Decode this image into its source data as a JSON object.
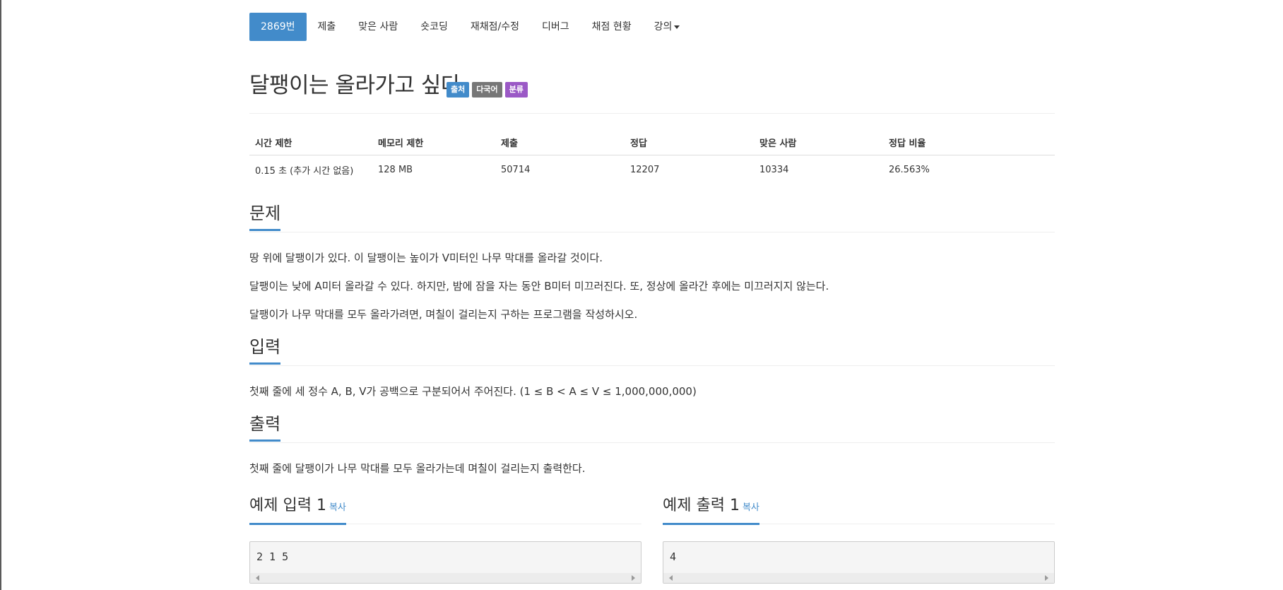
{
  "tabs": [
    {
      "label": "2869번"
    },
    {
      "label": "제출"
    },
    {
      "label": "맞은 사람"
    },
    {
      "label": "숏코딩"
    },
    {
      "label": "재채점/수정"
    },
    {
      "label": "디버그"
    },
    {
      "label": "채점 현황"
    },
    {
      "label": "강의"
    }
  ],
  "title": "달팽이는 올라가고 싶다",
  "labels": [
    {
      "text": "출처",
      "color": "#428bca"
    },
    {
      "text": "다국어",
      "color": "#777777"
    },
    {
      "text": "분류",
      "color": "#9b59c6"
    }
  ],
  "info": {
    "headers": [
      "시간 제한",
      "메모리 제한",
      "제출",
      "정답",
      "맞은 사람",
      "정답 비율"
    ],
    "values": [
      "0.15 초 (추가 시간 없음)",
      "128 MB",
      "50714",
      "12207",
      "10334",
      "26.563%"
    ]
  },
  "sections": {
    "problem": {
      "title": "문제",
      "paragraphs": [
        "땅 위에 달팽이가 있다. 이 달팽이는 높이가 V미터인 나무 막대를 올라갈 것이다.",
        "달팽이는 낮에 A미터 올라갈 수 있다. 하지만, 밤에 잠을 자는 동안 B미터 미끄러진다. 또, 정상에 올라간 후에는 미끄러지지 않는다.",
        "달팽이가 나무 막대를 모두 올라가려면, 며칠이 걸리는지 구하는 프로그램을 작성하시오."
      ]
    },
    "input": {
      "title": "입력",
      "paragraphs": [
        "첫째 줄에 세 정수 A, B, V가 공백으로 구분되어서 주어진다. (1 ≤ B < A ≤ V ≤ 1,000,000,000)"
      ]
    },
    "output": {
      "title": "출력",
      "paragraphs": [
        "첫째 줄에 달팽이가 나무 막대를 모두 올라가는데 며칠이 걸리는지 출력한다."
      ]
    }
  },
  "examples": {
    "input": {
      "title": "예제 입력 1",
      "copy": "복사",
      "content": "2 1 5"
    },
    "output": {
      "title": "예제 출력 1",
      "copy": "복사",
      "content": "4"
    }
  },
  "colors": {
    "accent": "#428bca"
  }
}
